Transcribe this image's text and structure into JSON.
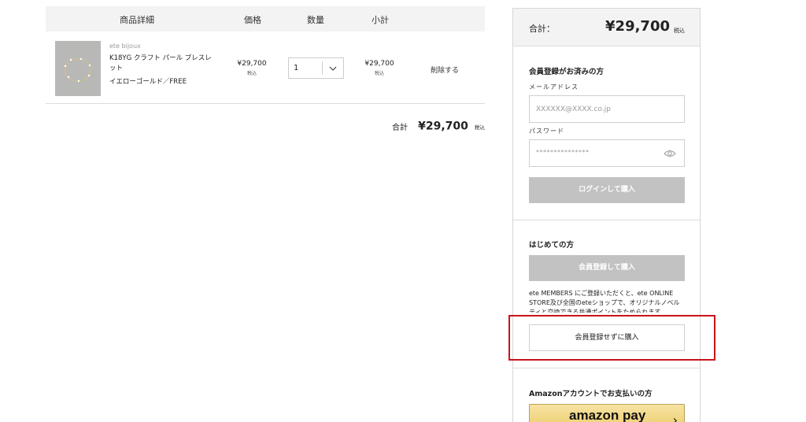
{
  "cart": {
    "headers": {
      "details": "商品詳細",
      "price": "価格",
      "quantity": "数量",
      "subtotal": "小計"
    },
    "item": {
      "brand": "ete bijoux",
      "name": "K18YG クラフト パール ブレスレット",
      "variant": "イエローゴールド／FREE",
      "price": "¥29,700",
      "price_tax": "税込",
      "quantity": "1",
      "subtotal": "¥29,700",
      "subtotal_tax": "税込",
      "delete_label": "削除する"
    },
    "total": {
      "label": "合計",
      "value": "¥29,700",
      "tax": "税込"
    }
  },
  "panel": {
    "total": {
      "label": "合計：",
      "value": "¥29,700",
      "tax": "税込"
    },
    "members": {
      "title": "会員登録がお済みの方",
      "email_label": "メールアドレス",
      "email_placeholder": "XXXXXX@XXXX.co.jp",
      "password_label": "パスワード",
      "password_mask": "***************",
      "login_button": "ログインして購入"
    },
    "first_time": {
      "title": "はじめての方",
      "register_button": "会員登録して購入",
      "description": "ete MEMBERS にご登録いただくと、ete ONLINE STORE及び全国のeteショップで、オリジナルノベルティと交換できる共通ポイントをためられます。",
      "guest_button": "会員登録せずに購入"
    },
    "amazon": {
      "title": "Amazonアカウントでお支払いの方",
      "button_text": "amazon pay"
    }
  },
  "colors": {
    "highlight": "#c8141a",
    "disabled_button": "#c2c2c2",
    "header_bg": "#f3f3f3",
    "amazon_gold": "#f0d37a"
  },
  "icons": {
    "eye": "eye-icon",
    "chevron": "chevron-down-icon",
    "amazon_arrow": "chevron-right-icon"
  }
}
